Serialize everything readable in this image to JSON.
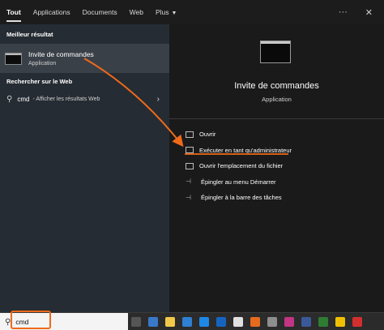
{
  "tabs": [
    {
      "label": "Tout",
      "active": true
    },
    {
      "label": "Applications"
    },
    {
      "label": "Documents"
    },
    {
      "label": "Web"
    },
    {
      "label": "Plus"
    }
  ],
  "tabs_right": {
    "more": "···",
    "close": "✕"
  },
  "left": {
    "best_header": "Meilleur résultat",
    "best_title": "Invite de commandes",
    "best_sub": "Application",
    "web_header": "Rechercher sur le Web",
    "web_query": "cmd",
    "web_hint": "- Afficher les résultats Web"
  },
  "preview": {
    "title": "Invite de commandes",
    "subtitle": "Application"
  },
  "actions": [
    {
      "label": "Ouvrir",
      "icon": "open-icon"
    },
    {
      "label": "Exécuter en tant qu'administrateur",
      "icon": "shield-icon"
    },
    {
      "label": "Ouvrir l'emplacement du fichier",
      "icon": "folder-icon"
    },
    {
      "label": "Épingler au menu Démarrer",
      "icon": "pin-icon"
    },
    {
      "label": "Épingler à la barre des tâches",
      "icon": "pin-icon"
    }
  ],
  "taskbar": {
    "search_value": "cmd"
  },
  "colors": {
    "annotation": "#f06a1a",
    "left_panel": "#262c33",
    "right_panel": "#1a1a1a"
  }
}
